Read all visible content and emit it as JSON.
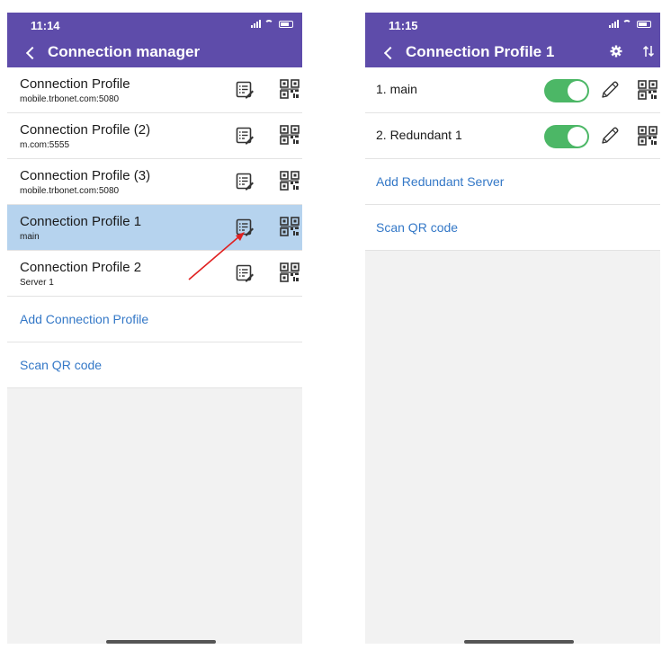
{
  "left": {
    "status_time": "11:14",
    "title": "Connection manager",
    "profiles": [
      {
        "name": "Connection Profile",
        "subtitle": "mobile.trbonet.com:5080",
        "selected": false
      },
      {
        "name": "Connection Profile (2)",
        "subtitle": "m.com:5555",
        "selected": false
      },
      {
        "name": "Connection Profile (3)",
        "subtitle": "mobile.trbonet.com:5080",
        "selected": false
      },
      {
        "name": "Connection Profile 1",
        "subtitle": "main",
        "selected": true
      },
      {
        "name": "Connection Profile 2",
        "subtitle": "Server 1",
        "selected": false
      }
    ],
    "add_label": "Add Connection Profile",
    "scan_label": "Scan QR code"
  },
  "right": {
    "status_time": "11:15",
    "title": "Connection Profile 1",
    "servers": [
      {
        "name": "1. main",
        "enabled": true
      },
      {
        "name": "2. Redundant 1",
        "enabled": true
      }
    ],
    "add_label": "Add Redundant Server",
    "scan_label": "Scan QR code"
  },
  "colors": {
    "header": "#5e4caa",
    "selected_row": "#b6d3ee",
    "link": "#3478c7",
    "toggle_on": "#4cb766",
    "annotation_arrow": "#e02020"
  },
  "icons": {
    "edit": "edit-list-icon",
    "qr": "qr-code-icon",
    "settings": "gear-icon",
    "sort": "sort-icon",
    "pencil": "pencil-icon",
    "back": "chevron-left-icon"
  }
}
